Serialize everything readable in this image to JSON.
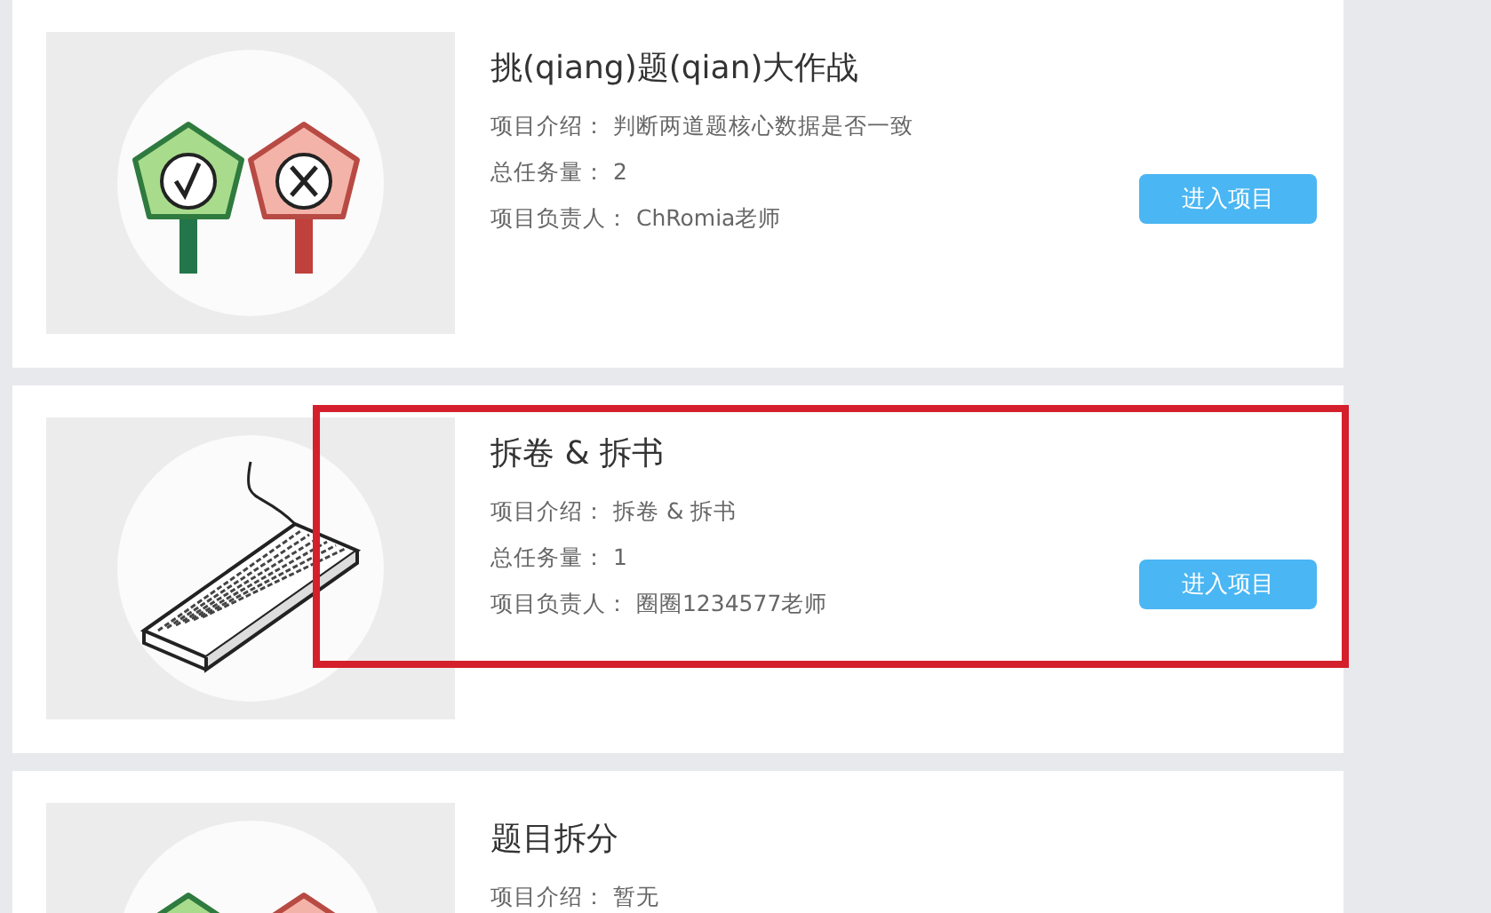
{
  "projects": [
    {
      "title": "挑(qiang)题(qian)大作战",
      "thumbnail": {
        "kind": "signs"
      },
      "highlighted": false,
      "fields": [
        {
          "label": "项目介绍：",
          "value": "判断两道题核心数据是否一致"
        },
        {
          "label": "总任务量：",
          "value": "2"
        },
        {
          "label": "项目负责人：",
          "value": "ChRomia老师"
        }
      ],
      "button": "进入项目"
    },
    {
      "title": "拆卷 & 拆书",
      "thumbnail": {
        "kind": "keyboard"
      },
      "highlighted": true,
      "fields": [
        {
          "label": "项目介绍：",
          "value": "拆卷 & 拆书"
        },
        {
          "label": "总任务量：",
          "value": "1"
        },
        {
          "label": "项目负责人：",
          "value": "圈圈1234577老师"
        }
      ],
      "button": "进入项目"
    },
    {
      "title": "题目拆分",
      "thumbnail": {
        "kind": "signs"
      },
      "highlighted": false,
      "fields": [
        {
          "label": "项目介绍：",
          "value": "暂无"
        }
      ]
    }
  ]
}
